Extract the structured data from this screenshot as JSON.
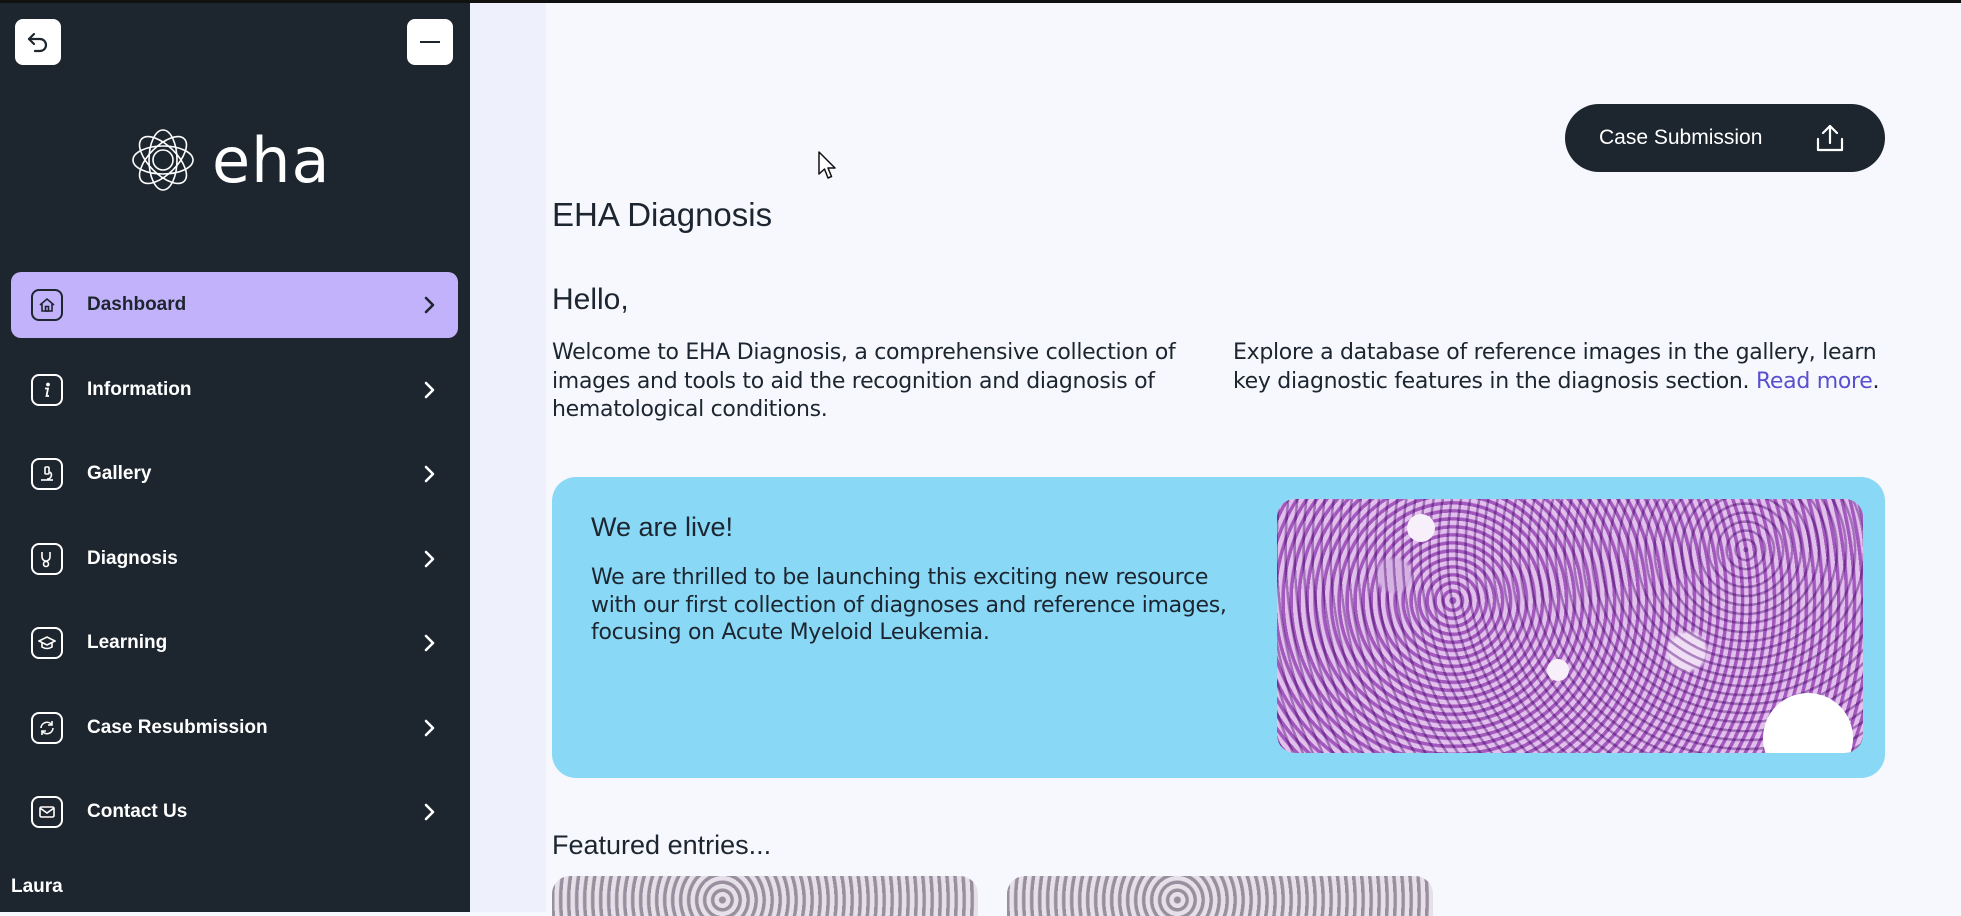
{
  "sidebar": {
    "logo_text": "eha",
    "items": [
      {
        "label": "Dashboard"
      },
      {
        "label": "Information"
      },
      {
        "label": "Gallery"
      },
      {
        "label": "Diagnosis"
      },
      {
        "label": "Learning"
      },
      {
        "label": "Case Resubmission"
      },
      {
        "label": "Contact Us"
      }
    ],
    "user_name": "Laura"
  },
  "header": {
    "case_submission_label": "Case Submission"
  },
  "main": {
    "title": "EHA Diagnosis",
    "greeting": "Hello,",
    "intro_left": "Welcome to EHA Diagnosis, a comprehensive collection of images and tools to aid the recognition and diagnosis of hematological conditions.",
    "intro_right": "Explore a database of reference images in the gallery, learn key diagnostic features in the diagnosis section.",
    "read_more": "Read more",
    "read_more_suffix": ".",
    "banner": {
      "title": "We are live!",
      "text": "We are thrilled to be launching this exciting new resource with our first collection of diagnoses and reference images, focusing on Acute Myeloid Leukemia."
    },
    "featured_title": "Featured entries..."
  },
  "colors": {
    "sidebar_bg": "#1d252e",
    "active_item": "#c2b2fb",
    "banner_bg": "#89d8f5",
    "link": "#5a4fcf",
    "page_bg": "#f6f8fd"
  }
}
